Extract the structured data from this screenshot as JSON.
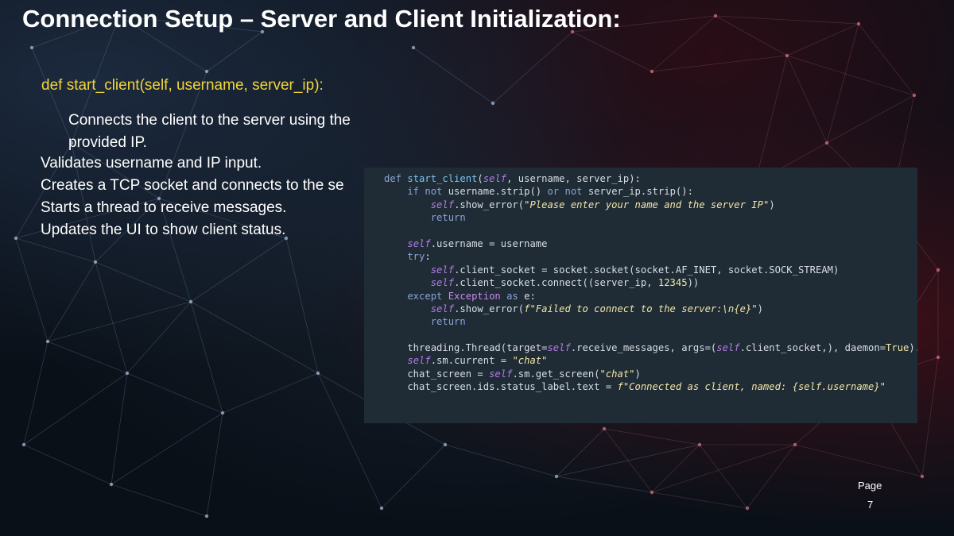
{
  "slide": {
    "title": "Connection Setup – Server and Client Initialization:",
    "function_signature": "def start_client(self, username, server_ip):",
    "description": "Connects the client to the server using the provided IP.",
    "bullets": [
      "Validates username and IP input.",
      "Creates a TCP socket and connects to the se",
      "Starts a thread to receive messages.",
      "Updates the UI to show client status."
    ],
    "page_label": "Page",
    "page_number": "7"
  },
  "code_snippet": {
    "lines": [
      [
        {
          "t": "def ",
          "c": "kw"
        },
        {
          "t": "start_client",
          "c": "fn"
        },
        {
          "t": "(",
          "c": ""
        },
        {
          "t": "self",
          "c": "self"
        },
        {
          "t": ", username, server_ip):",
          "c": ""
        }
      ],
      [
        {
          "t": "    if not ",
          "c": "kw"
        },
        {
          "t": "username.strip() ",
          "c": ""
        },
        {
          "t": "or not ",
          "c": "kw"
        },
        {
          "t": "server_ip.strip():",
          "c": ""
        }
      ],
      [
        {
          "t": "        ",
          "c": ""
        },
        {
          "t": "self",
          "c": "self"
        },
        {
          "t": ".show_error(",
          "c": ""
        },
        {
          "t": "\"Please enter your name and the server IP\"",
          "c": "str"
        },
        {
          "t": ")",
          "c": ""
        }
      ],
      [
        {
          "t": "        return",
          "c": "kw"
        }
      ],
      [
        {
          "t": "",
          "c": ""
        }
      ],
      [
        {
          "t": "    ",
          "c": ""
        },
        {
          "t": "self",
          "c": "self"
        },
        {
          "t": ".username = username",
          "c": ""
        }
      ],
      [
        {
          "t": "    try",
          "c": "kw"
        },
        {
          "t": ":",
          "c": ""
        }
      ],
      [
        {
          "t": "        ",
          "c": ""
        },
        {
          "t": "self",
          "c": "self"
        },
        {
          "t": ".client_socket = socket.socket(socket.AF_INET, socket.SOCK_STREAM)",
          "c": ""
        }
      ],
      [
        {
          "t": "        ",
          "c": ""
        },
        {
          "t": "self",
          "c": "self"
        },
        {
          "t": ".client_socket.connect((server_ip, ",
          "c": ""
        },
        {
          "t": "12345",
          "c": "num"
        },
        {
          "t": "))",
          "c": ""
        }
      ],
      [
        {
          "t": "    except ",
          "c": "kw"
        },
        {
          "t": "Exception ",
          "c": "exc"
        },
        {
          "t": "as ",
          "c": "kw"
        },
        {
          "t": "e:",
          "c": ""
        }
      ],
      [
        {
          "t": "        ",
          "c": ""
        },
        {
          "t": "self",
          "c": "self"
        },
        {
          "t": ".show_error(",
          "c": ""
        },
        {
          "t": "f\"Failed to connect to the server:\\n{e}\"",
          "c": "str"
        },
        {
          "t": ")",
          "c": ""
        }
      ],
      [
        {
          "t": "        return",
          "c": "kw"
        }
      ],
      [
        {
          "t": "",
          "c": ""
        }
      ],
      [
        {
          "t": "    threading.Thread(target=",
          "c": ""
        },
        {
          "t": "self",
          "c": "self"
        },
        {
          "t": ".receive_messages, args=(",
          "c": ""
        },
        {
          "t": "self",
          "c": "self"
        },
        {
          "t": ".client_socket,), daemon=",
          "c": ""
        },
        {
          "t": "True",
          "c": "num"
        },
        {
          "t": ").start()",
          "c": ""
        }
      ],
      [
        {
          "t": "    ",
          "c": ""
        },
        {
          "t": "self",
          "c": "self"
        },
        {
          "t": ".sm.current = ",
          "c": ""
        },
        {
          "t": "\"chat\"",
          "c": "str"
        }
      ],
      [
        {
          "t": "    chat_screen = ",
          "c": ""
        },
        {
          "t": "self",
          "c": "self"
        },
        {
          "t": ".sm.get_screen(",
          "c": ""
        },
        {
          "t": "\"chat\"",
          "c": "str"
        },
        {
          "t": ")",
          "c": ""
        }
      ],
      [
        {
          "t": "    chat_screen.ids.status_label.text = ",
          "c": ""
        },
        {
          "t": "f\"Connected as client, named: {self.username}\"",
          "c": "str"
        }
      ]
    ]
  }
}
